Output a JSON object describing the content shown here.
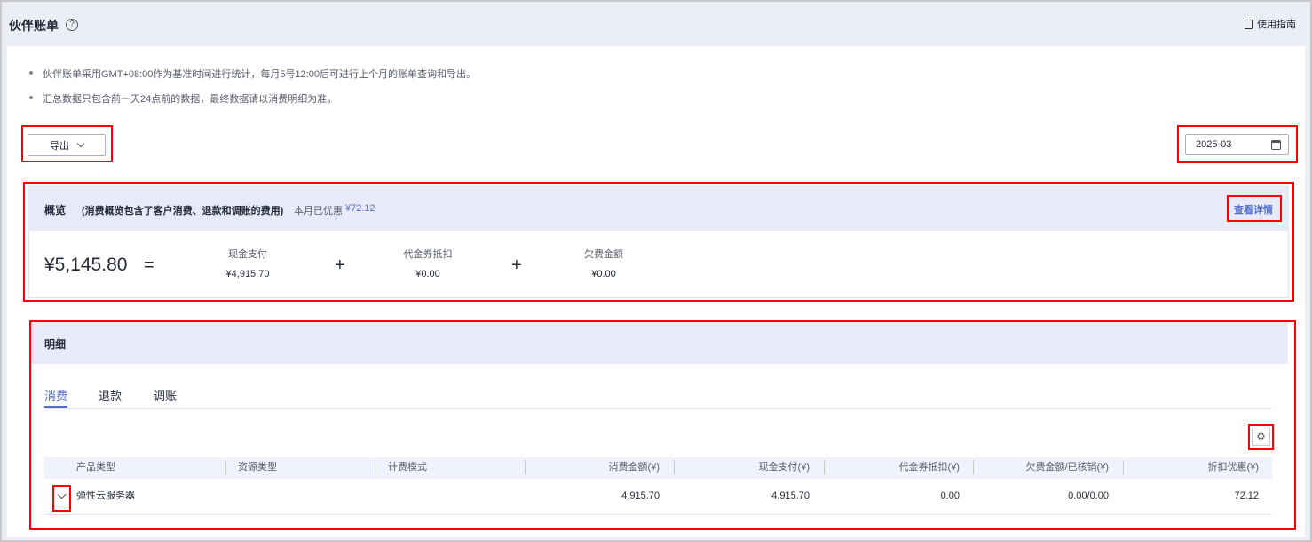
{
  "header": {
    "title": "伙伴账单",
    "guide_label": "使用指南"
  },
  "notes": [
    "伙伴账单采用GMT+08:00作为基准时间进行统计，每月5号12:00后可进行上个月的账单查询和导出。",
    "汇总数据只包含前一天24点前的数据，最终数据请以消费明细为准。"
  ],
  "toolbar": {
    "export_label": "导出",
    "month_value": "2025-03"
  },
  "overview": {
    "title": "概览",
    "subtitle": "(消费概览包含了客户消费、退款和调账的费用)",
    "discount_label": "本月已优惠",
    "discount_value": "¥72.12",
    "details_link": "查看详情",
    "total": "¥5,145.80",
    "equals": "=",
    "plus": "+",
    "items": [
      {
        "label": "现金支付",
        "value": "¥4,915.70"
      },
      {
        "label": "代金券抵扣",
        "value": "¥0.00"
      },
      {
        "label": "欠费金额",
        "value": "¥0.00"
      }
    ]
  },
  "detail": {
    "title": "明细",
    "tabs": [
      "消费",
      "退款",
      "调账"
    ],
    "active_tab": "消费",
    "columns": [
      "产品类型",
      "资源类型",
      "计费模式",
      "消费金额(¥)",
      "现金支付(¥)",
      "代金券抵扣(¥)",
      "欠费金额/已核销(¥)",
      "折扣优惠(¥)"
    ],
    "rows": [
      [
        "弹性云服务器",
        "",
        "",
        "4,915.70",
        "4,915.70",
        "0.00",
        "0.00/0.00",
        "72.12"
      ]
    ]
  },
  "colors": {
    "accent": "#526ecc",
    "highlight": "#ff0000",
    "header_band": "#e8ebf7"
  }
}
